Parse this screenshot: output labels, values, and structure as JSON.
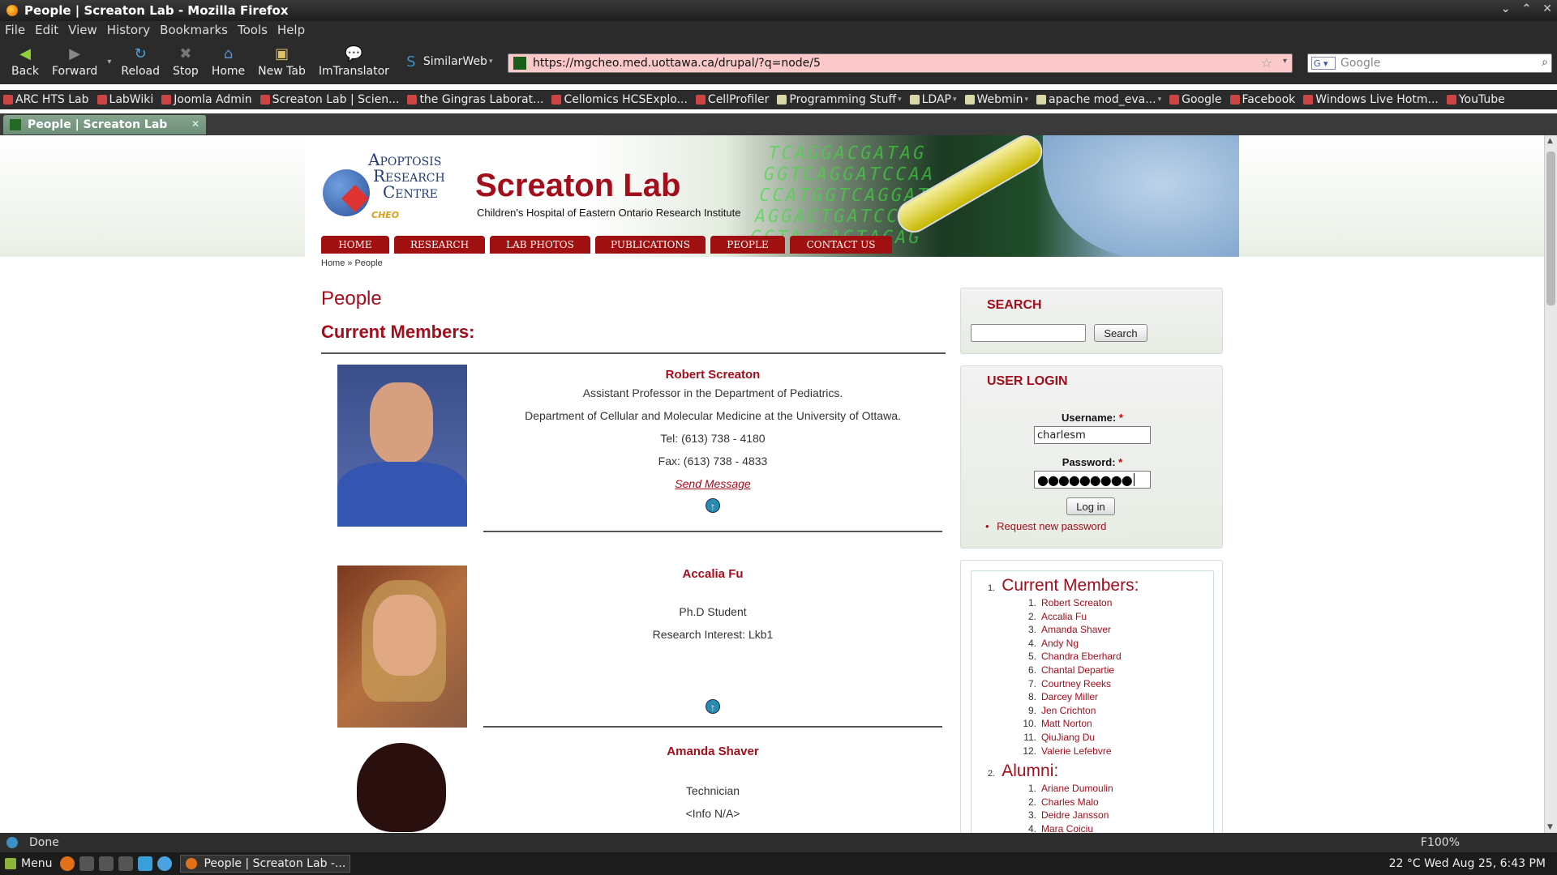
{
  "window": {
    "title": "People | Screaton Lab - Mozilla Firefox"
  },
  "menu": [
    "File",
    "Edit",
    "View",
    "History",
    "Bookmarks",
    "Tools",
    "Help"
  ],
  "toolbar": {
    "back": "Back",
    "forward": "Forward",
    "reload": "Reload",
    "stop": "Stop",
    "home": "Home",
    "new_tab": "New Tab",
    "imtranslator": "ImTranslator",
    "similarweb": "SimilarWeb"
  },
  "url": "https://mgcheo.med.uottawa.ca/drupal/?q=node/5",
  "search_engine_placeholder": "Google",
  "bookmarks": [
    {
      "label": "ARC HTS Lab",
      "type": "link"
    },
    {
      "label": "LabWiki",
      "type": "link"
    },
    {
      "label": "Joomla Admin",
      "type": "link"
    },
    {
      "label": "Screaton Lab | Scien...",
      "type": "link"
    },
    {
      "label": "the Gingras Laborat...",
      "type": "link"
    },
    {
      "label": "Cellomics HCSExplo...",
      "type": "link"
    },
    {
      "label": "CellProfiler",
      "type": "link"
    },
    {
      "label": "Programming Stuff",
      "type": "folder"
    },
    {
      "label": "LDAP",
      "type": "folder"
    },
    {
      "label": "Webmin",
      "type": "folder"
    },
    {
      "label": "apache mod_eva...",
      "type": "folder"
    },
    {
      "label": "Google",
      "type": "link"
    },
    {
      "label": "Facebook",
      "type": "link"
    },
    {
      "label": "Windows Live Hotm...",
      "type": "link"
    },
    {
      "label": "YouTube",
      "type": "link"
    }
  ],
  "tab": {
    "title": "People | Screaton Lab"
  },
  "site": {
    "logo_lines": [
      "Apoptosis",
      "Research",
      "Centre"
    ],
    "logo_cheo": "CHEO",
    "title": "Screaton Lab",
    "subtitle": "Children's Hospital of Eastern Ontario Research Institute",
    "dna_text": "TCAGGACGATAG\nGGTCAGGATCCAA\nCCATGGTCAGGATCC\nAGGACTGATCCAG\nGCTAGCAGTACAG",
    "nav": [
      "HOME",
      "RESEARCH",
      "LAB PHOTOS",
      "PUBLICATIONS",
      "PEOPLE",
      "CONTACT US"
    ],
    "breadcrumb": {
      "home": "Home",
      "sep": "»",
      "current": "People"
    }
  },
  "content": {
    "page_title": "People",
    "section_title": "Current Members:",
    "people": [
      {
        "name": "Robert Screaton",
        "lines": [
          "Assistant Professor in the Department of Pediatrics.",
          "Department of Cellular and Molecular Medicine at the University of Ottawa.",
          "Tel:  (613) 738 - 4180",
          "Fax: (613) 738 - 4833"
        ],
        "message": "Send Message"
      },
      {
        "name": "Accalia Fu",
        "lines": [
          "Ph.D Student",
          "Research Interest: Lkb1"
        ]
      },
      {
        "name": "Amanda Shaver",
        "lines": [
          "Technician",
          "<Info N/A>"
        ]
      }
    ]
  },
  "sidebar": {
    "search": {
      "title": "SEARCH",
      "button": "Search"
    },
    "login": {
      "title": "USER LOGIN",
      "username_label": "Username:",
      "password_label": "Password:",
      "required": "*",
      "username": "charlesm",
      "password_mask": "●●●●●●●●●",
      "button": "Log in",
      "request_pw": "Request new password"
    },
    "toc": {
      "sections": [
        {
          "num": "1.",
          "title": "Current Members:",
          "items": [
            "Robert Screaton",
            "Accalia Fu",
            "Amanda Shaver",
            "Andy Ng",
            "Chandra Eberhard",
            "Chantal Departie",
            "Courtney Reeks",
            "Darcey Miller",
            "Jen Crichton",
            "Matt Norton",
            "QiuJiang Du",
            "Valerie Lefebvre"
          ]
        },
        {
          "num": "2.",
          "title": "Alumni:",
          "items": [
            "Ariane Dumoulin",
            "Charles Malo",
            "Deidre Jansson",
            "Mara Coiciu"
          ]
        }
      ]
    }
  },
  "status": {
    "text": "Done",
    "zoom": "F100%"
  },
  "taskbar": {
    "menu": "Menu",
    "task": "People | Screaton Lab -...",
    "clock": "22 °C   Wed Aug 25,  6:43 PM"
  }
}
